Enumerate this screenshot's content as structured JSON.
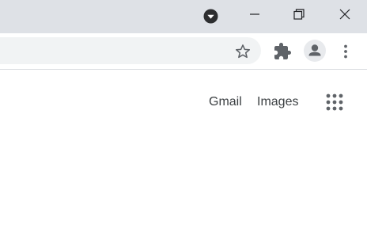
{
  "window_controls": {
    "tab_search": "tab-search-icon",
    "minimize": "minimize-icon",
    "restore": "restore-icon",
    "close": "close-icon"
  },
  "toolbar": {
    "bookmark_icon": "star-icon",
    "extensions_icon": "puzzle-icon",
    "profile_icon": "person-icon",
    "menu_icon": "more-vert-icon"
  },
  "page": {
    "gmail_link": "Gmail",
    "images_link": "Images",
    "apps_icon": "apps-grid-icon"
  },
  "colors": {
    "titlebar_bg": "#dee1e6",
    "omnibox_bg": "#f1f3f4",
    "icon": "#5f6368",
    "text": "#3c4043"
  }
}
